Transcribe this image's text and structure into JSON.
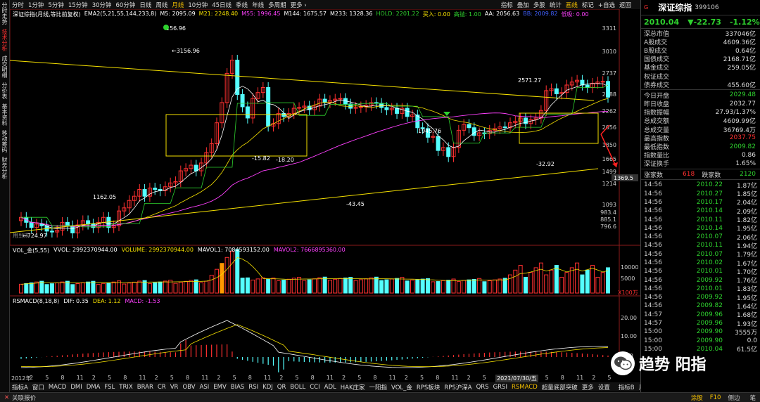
{
  "leftbar": [
    "分时走势",
    "技术分析",
    "成交明细",
    "分价表",
    "基本资料",
    "移动筹码",
    "财务分析"
  ],
  "topbar": [
    "分时",
    "1分钟",
    "5分钟",
    "15分钟",
    "30分钟",
    "60分钟",
    "日线",
    "周线",
    "月线",
    "10分钟",
    "45日线",
    "季线",
    "年线",
    "多周期",
    "更多 ›"
  ],
  "toolbar": [
    "指标",
    "叠加",
    "多股",
    "统计",
    "画线",
    "标记",
    "+自选",
    "返回"
  ],
  "info": {
    "name": "深证综指(月线,等比前复权)",
    "ema": "EMA2(5,21,55,144,233,8)",
    "m5": "M5: 2095.09",
    "m21": "M21: 2248.40",
    "m55": "M55: 1996.45",
    "m144": "M144: 1675.57",
    "m233": "M233: 1328.36",
    "hold": "HOLD: 2201.22",
    "buy": "买入: 0.00",
    "high": "高抛: 1.00",
    "aa": "AA: 2056.63",
    "bb": "BB: 2009.82",
    "low": "低吸: 0.00"
  },
  "yaxis": [
    "3311",
    "3010",
    "2737",
    "2488",
    "2262",
    "2056",
    "1850",
    "1665",
    "1499",
    "1369.5",
    "1214",
    "1093",
    "983.4",
    "885.1",
    "796.6"
  ],
  "price_labels": {
    "peak": "3156.96",
    "peak_top": "156.96",
    "left_low": "1162.05",
    "start": "724.97",
    "m1": "-15.82",
    "m2": "-18.20",
    "bottom": "-43.45",
    "mid": "1945.76",
    "top2": "2571.27",
    "m3": "-32.92"
  },
  "vol": {
    "label": "VOL_金(5,55)",
    "vvol": "VVOL: 2992370944.00",
    "volume": "VOLUME: 2992370944.00",
    "mavol1": "MAVOL1: 7084593152.00",
    "mavol2": "MAVOL2: 7666895360.00",
    "y1": "10000",
    "y2": "5000",
    "unit": "X100万"
  },
  "macd": {
    "label": "RSMACD(8,18,8)",
    "dif": "DIF: 0.35",
    "dea": "DEA: 1.12",
    "macd": "MACD: -1.53",
    "y1": "20.00",
    "y2": "10.00",
    "y3": "0.00"
  },
  "xaxis": [
    "2012年",
    "2",
    "5",
    "8",
    "11",
    "2",
    "5",
    "8",
    "11",
    "2",
    "5",
    "8",
    "11",
    "2",
    "5",
    "8",
    "11",
    "2",
    "5",
    "8",
    "11",
    "2",
    "5",
    "8",
    "11",
    "2",
    "5",
    "8",
    "11",
    "2",
    "5",
    "8",
    "11",
    "2",
    "5",
    "8",
    "11",
    "2",
    "5"
  ],
  "date_tag": "2021/07/30/五",
  "bottomtabs": [
    "指标A",
    "窗口",
    "MACD",
    "DMI",
    "DMA",
    "FSL",
    "TRIX",
    "BRAR",
    "CR",
    "VR",
    "OBV",
    "ASI",
    "EMV",
    "BIAS",
    "RSI",
    "KDJ",
    "QR",
    "BOLL",
    "CCI",
    "ADL",
    "HAK庄家",
    "一阳指",
    "VOL_金",
    "RPS板块",
    "RPS沪深A",
    "QRS",
    "GRSI",
    "RSMACD",
    "超量底部突破",
    "更多",
    "设置"
  ],
  "bottom_right": [
    "指标B",
    "月"
  ],
  "status": {
    "left": "关联报价",
    "right1": "涂股",
    "right2": "F10",
    "right3": "侧边",
    "right4": "笔"
  },
  "panel": {
    "flag": "G",
    "name": "深证综指",
    "code": "399106",
    "price": "2010.04",
    "change": "▼-22.73",
    "pct": "-1.12%",
    "rows1": [
      [
        "深总市值",
        "337046亿"
      ],
      [
        "A股成交",
        "4609.36亿"
      ],
      [
        "B股成交",
        "0.64亿"
      ],
      [
        "国债成交",
        "2168.71亿"
      ],
      [
        "基金成交",
        "259.05亿"
      ],
      [
        "权证成交",
        ""
      ],
      [
        "债券成交",
        "455.60亿"
      ]
    ],
    "rows2": [
      [
        "今日开盘",
        "2029.48"
      ],
      [
        "昨日收盘",
        "2032.77"
      ],
      [
        "指数振幅",
        "27.93/1.37%"
      ],
      [
        "总成交额",
        "4609.99亿"
      ],
      [
        "总成交量",
        "36769.4万"
      ],
      [
        "最高指数",
        "2037.75"
      ],
      [
        "最低指数",
        "2009.82"
      ],
      [
        "指数量比",
        "0.86"
      ],
      [
        "深证换手",
        "1.65%"
      ]
    ],
    "updown": {
      "up_label": "涨家数",
      "up": "618",
      "down_label": "跌家数",
      "down": "2120"
    },
    "ticks": [
      [
        "14:56",
        "2010.22",
        "1.87亿"
      ],
      [
        "14:56",
        "2010.27",
        "1.85亿"
      ],
      [
        "14:56",
        "2010.17",
        "2.04亿"
      ],
      [
        "14:56",
        "2010.14",
        "2.09亿"
      ],
      [
        "14:56",
        "2010.11",
        "1.82亿"
      ],
      [
        "14:56",
        "2010.14",
        "1.95亿"
      ],
      [
        "14:56",
        "2010.07",
        "2.06亿"
      ],
      [
        "14:56",
        "2010.11",
        "1.94亿"
      ],
      [
        "14:56",
        "2010.07",
        "1.79亿"
      ],
      [
        "14:56",
        "2010.02",
        "1.67亿"
      ],
      [
        "14:56",
        "2010.01",
        "1.70亿"
      ],
      [
        "14:56",
        "2009.92",
        "1.76亿"
      ],
      [
        "14:56",
        "2010.01",
        "1.83亿"
      ],
      [
        "14:56",
        "2009.92",
        "1.95亿"
      ],
      [
        "14:56",
        "2009.82",
        "1.64亿"
      ],
      [
        "14:57",
        "2009.96",
        "1.68亿"
      ],
      [
        "14:57",
        "2009.96",
        "1.93亿"
      ],
      [
        "15:00",
        "2009.90",
        "3555万"
      ],
      [
        "15:00",
        "2009.90",
        "0.0"
      ],
      [
        "15:00",
        "2010.04",
        "61.5亿"
      ]
    ]
  },
  "watermark": "趋势 阳指",
  "colors": {
    "up": "#ff3030",
    "down": "#54ffff",
    "green": "#2ed12e",
    "yellow": "#f5e000"
  }
}
